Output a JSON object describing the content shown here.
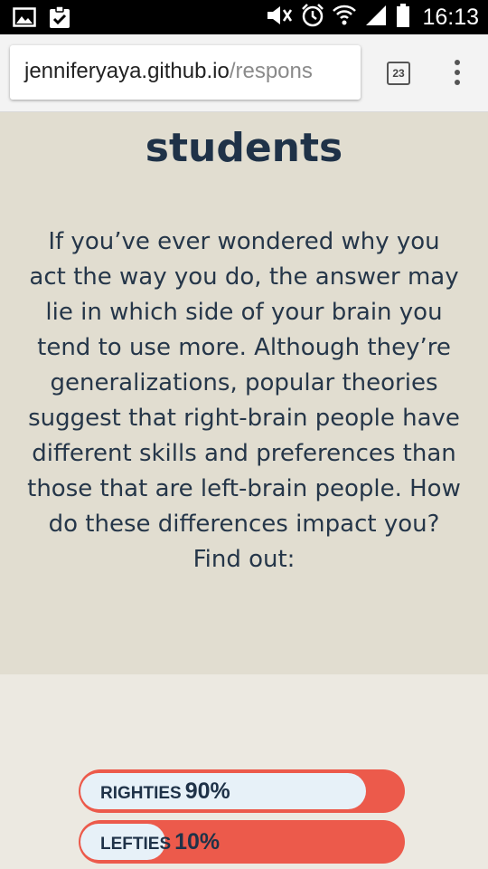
{
  "status_bar": {
    "time": "16:13",
    "icons": [
      "image-icon",
      "clipboard-check-icon",
      "mute-icon",
      "alarm-icon",
      "wifi-icon",
      "signal-icon",
      "battery-icon"
    ]
  },
  "browser": {
    "url_host": "jenniferyaya.github.io",
    "url_path": "/respons",
    "tab_count": "23"
  },
  "hero": {
    "title_line": "students",
    "body": "If you’ve ever wondered why you act the way you do, the answer may lie in which side of your brain you tend to use more. Although they’re generalizations, popular theories suggest that right-brain people have different skills and preferences than those that are left-brain people. How do these differences impact you? Find out:"
  },
  "stats": [
    {
      "name": "RIGHTIES",
      "percent_label": "90%",
      "value": 0.9
    },
    {
      "name": "LEFTIES",
      "percent_label": "10%",
      "value": 0.1
    }
  ],
  "colors": {
    "hero_bg": "#e1ddd0",
    "page_bg": "#ece9e1",
    "heading": "#1f3248",
    "bar_track": "#ec5a4b",
    "bar_fill": "#e7f1f8"
  }
}
